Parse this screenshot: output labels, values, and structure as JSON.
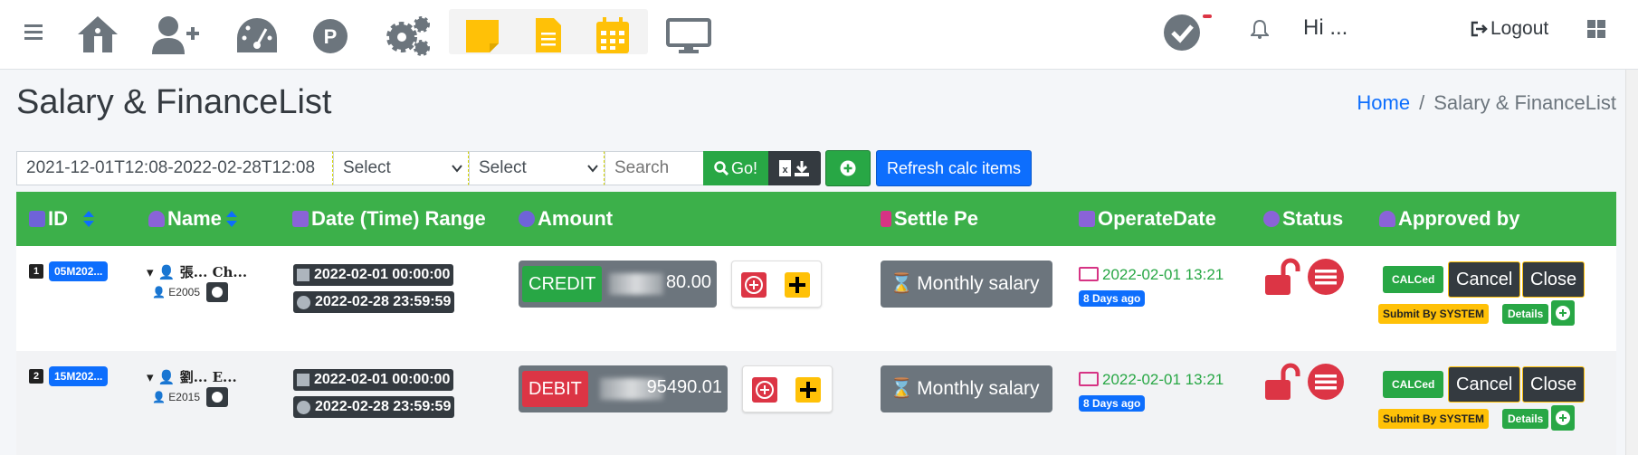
{
  "topbar": {
    "greeting": "Hi ...",
    "logout_label": "Logout",
    "icons": [
      "menu-icon",
      "home-icon",
      "user-plus-icon",
      "speedometer-icon",
      "parking-icon",
      "cogs-icon",
      "sticky-note-icon",
      "file-icon",
      "calendar-icon",
      "monitor-icon",
      "check-circle-icon",
      "bell-icon",
      "logout-icon",
      "grid-icon"
    ]
  },
  "page": {
    "title": "Salary & FinanceList",
    "breadcrumb": {
      "home": "Home",
      "current": "Salary & FinanceList"
    }
  },
  "filters": {
    "date_range": "2021-12-01T12:08-2022-02-28T12:08",
    "select1": "Select",
    "select2": "Select",
    "search_placeholder": "Search",
    "go_label": "Go!",
    "refresh_label": "Refresh calc items"
  },
  "table": {
    "columns": [
      "ID",
      "Name",
      "Date (Time) Range",
      "Amount",
      "Settle Pe",
      "OperateDate",
      "Status",
      "Approved by"
    ],
    "rows": [
      {
        "index": "1",
        "id": "05M202...",
        "name": "張... Ch...",
        "emp_id": "E2005",
        "start": "2022-02-01 00:00:00",
        "end": "2022-02-28 23:59:59",
        "type": "CREDIT",
        "amount": "80.00",
        "settle": "Monthly salary",
        "operate_date": "2022-02-01 13:21",
        "ago": "8 Days ago",
        "calc": "CALCed",
        "cancel": "Cancel",
        "close": "Close",
        "submit_by": "Submit By SYSTEM",
        "details": "Details"
      },
      {
        "index": "2",
        "id": "15M202...",
        "name": "劉... E...",
        "emp_id": "E2015",
        "start": "2022-02-01 00:00:00",
        "end": "2022-02-28 23:59:59",
        "type": "DEBIT",
        "amount": "95490.01",
        "settle": "Monthly salary",
        "operate_date": "2022-02-01 13:21",
        "ago": "8 Days ago",
        "calc": "CALCed",
        "cancel": "Cancel",
        "close": "Close",
        "submit_by": "Submit By SYSTEM",
        "details": "Details"
      }
    ]
  },
  "colors": {
    "header_green": "#3cb04a",
    "credit_green": "#28a745",
    "debit_red": "#dc3545",
    "primary_blue": "#0d6efd",
    "accent_yellow": "#ffc107"
  }
}
